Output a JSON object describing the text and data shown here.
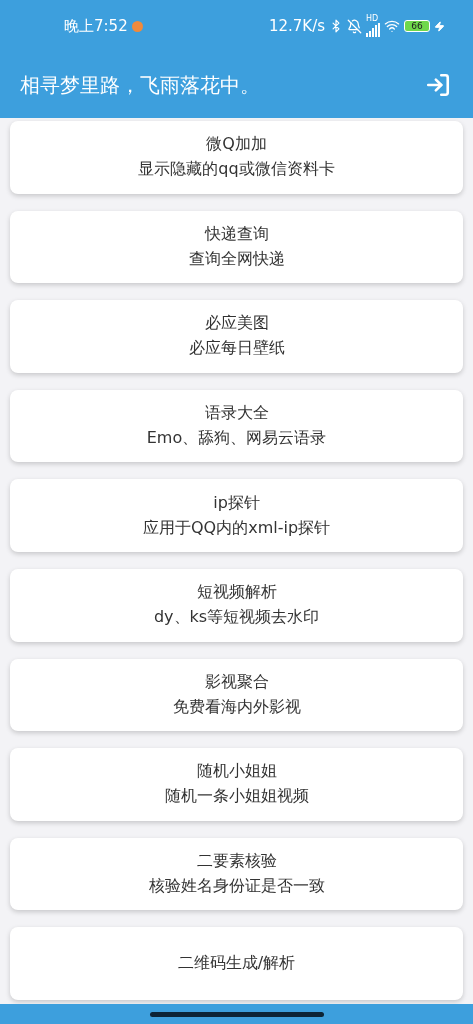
{
  "status_bar": {
    "time": "晚上7:52",
    "speed": "12.7K/s",
    "signal_label": "HD",
    "battery": "66"
  },
  "app_bar": {
    "title": "相寻梦里路，飞雨落花中。"
  },
  "cards": [
    {
      "title": "微Q加加",
      "subtitle": "显示隐藏的qq或微信资料卡"
    },
    {
      "title": "快递查询",
      "subtitle": "查询全网快递"
    },
    {
      "title": "必应美图",
      "subtitle": "必应每日壁纸"
    },
    {
      "title": "语录大全",
      "subtitle": "Emo、舔狗、网易云语录"
    },
    {
      "title": "ip探针",
      "subtitle": "应用于QQ内的xml-ip探针"
    },
    {
      "title": "短视频解析",
      "subtitle": "dy、ks等短视频去水印"
    },
    {
      "title": "影视聚合",
      "subtitle": "免费看海内外影视"
    },
    {
      "title": "随机小姐姐",
      "subtitle": "随机一条小姐姐视频"
    },
    {
      "title": "二要素核验",
      "subtitle": "核验姓名身份证是否一致"
    },
    {
      "title": "二维码生成/解析"
    }
  ]
}
